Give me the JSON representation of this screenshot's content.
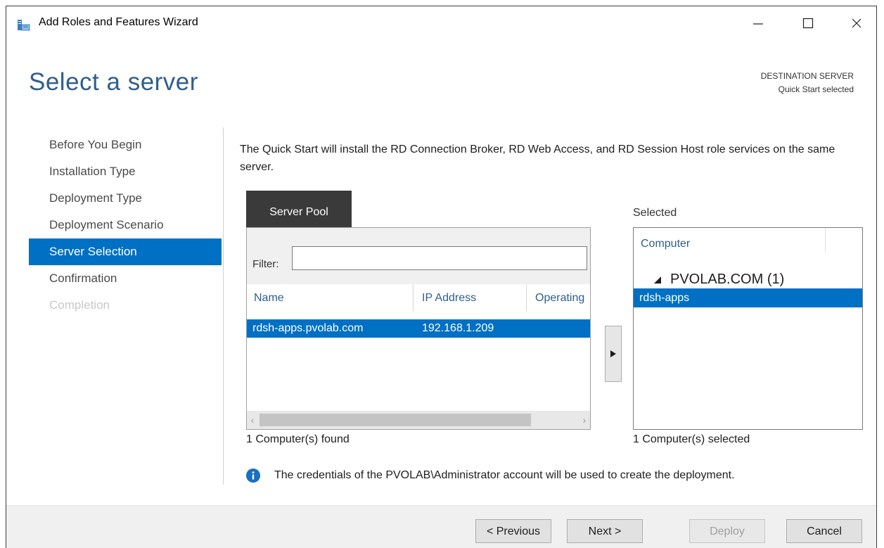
{
  "window": {
    "title": "Add Roles and Features Wizard",
    "icon": "server-manager-icon"
  },
  "header": {
    "page_title": "Select a server",
    "destination_label": "DESTINATION SERVER",
    "destination_value": "Quick Start selected"
  },
  "nav": {
    "items": [
      {
        "label": "Before You Begin",
        "state": "normal"
      },
      {
        "label": "Installation Type",
        "state": "normal"
      },
      {
        "label": "Deployment Type",
        "state": "normal"
      },
      {
        "label": "Deployment Scenario",
        "state": "normal"
      },
      {
        "label": "Server Selection",
        "state": "active"
      },
      {
        "label": "Confirmation",
        "state": "normal"
      },
      {
        "label": "Completion",
        "state": "disabled"
      }
    ]
  },
  "content": {
    "intro": "The Quick Start will install the RD Connection Broker, RD Web Access, and RD Session Host role services on the same server.",
    "pool": {
      "tab_label": "Server Pool",
      "filter_label": "Filter:",
      "filter_value": "",
      "columns": [
        "Name",
        "IP Address",
        "Operating"
      ],
      "rows": [
        {
          "name": "rdsh-apps.pvolab.com",
          "ip": "192.168.1.209",
          "os": ""
        }
      ],
      "found_text": "1 Computer(s) found"
    },
    "selected": {
      "label": "Selected",
      "column": "Computer",
      "group": "PVOLAB.COM (1)",
      "items": [
        "rdsh-apps"
      ],
      "count_text": "1 Computer(s) selected"
    },
    "info": "The credentials of the PVOLAB\\Administrator account will be used to create the deployment."
  },
  "footer": {
    "previous": "< Previous",
    "next": "Next >",
    "deploy": "Deploy",
    "cancel": "Cancel"
  },
  "colors": {
    "accent": "#0070c4",
    "title": "#2e5f8c",
    "tab": "#3a3a3a"
  }
}
